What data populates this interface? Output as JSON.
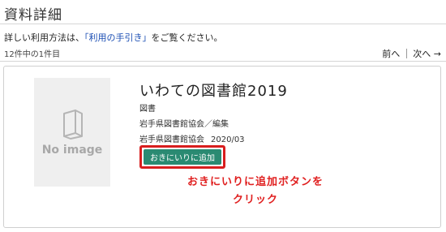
{
  "page": {
    "title": "資料詳細"
  },
  "help": {
    "before": "詳しい利用方法は、",
    "link": "「利用の手引き」",
    "after": "をご覧ください。"
  },
  "results": {
    "count": "12件中の1件目",
    "prev": "前へ",
    "next": "次へ →"
  },
  "record": {
    "no_image": "No image",
    "title": "いわての図書館2019",
    "type": "図書",
    "author": "岩手県図書館協会／編集",
    "publisher": "岩手県図書館協会",
    "date": "2020/03",
    "favorite_button": "おきにいりに追加"
  },
  "annotation": {
    "line1": "おきにいりに追加ボタンを",
    "line2": "クリック",
    "color": "#e02020"
  },
  "colors": {
    "button_bg": "#2a8a72",
    "highlight_border": "#d81e1e",
    "link": "#1a4db3"
  },
  "icons": {
    "placeholder": "book-icon",
    "next": "arrow-right"
  }
}
